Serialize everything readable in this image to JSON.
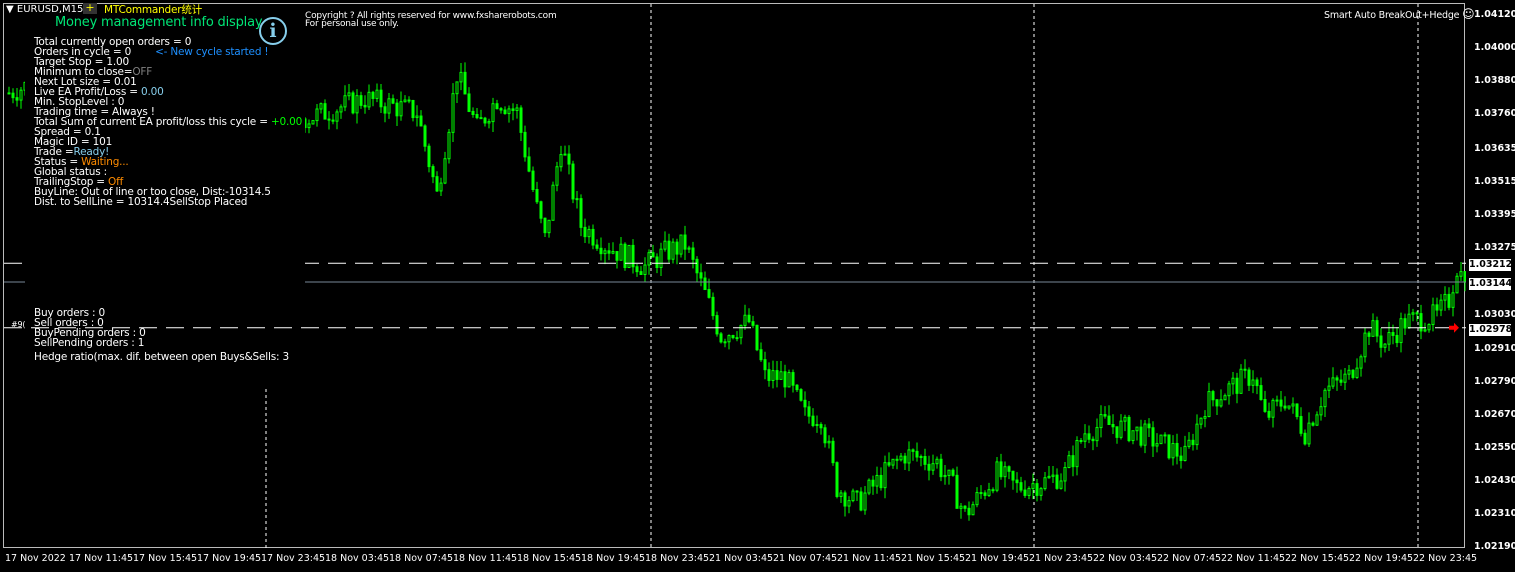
{
  "header": {
    "symbol": "EURUSD,M15",
    "plus_label": "+",
    "indicator_name": "MTCommander统计",
    "copyright_line1": "Copyright ? All rights reserved for www.fxsharerobots.com",
    "copyright_line2": "For personal use only.",
    "ea_name": "Smart Auto BreakOut+Hedge",
    "smiley": "☺"
  },
  "info": {
    "title": "Money management info display",
    "icon": "i",
    "lines": [
      {
        "label": "Total currently open orders = 0",
        "value": ""
      },
      {
        "label": "Orders in cycle = 0",
        "value": "<- New cycle started !"
      },
      {
        "label": "Target Stop = 1.00",
        "value": ""
      },
      {
        "label": "Minimum to close=",
        "value": "OFF"
      },
      {
        "label": "Next Lot size = 0.01",
        "value": ""
      },
      {
        "label": "Live EA Profit/Loss = ",
        "value": "0.00"
      },
      {
        "label": "Min. StopLevel : 0",
        "value": ""
      },
      {
        "label": "Trading time = Always !",
        "value": ""
      },
      {
        "label": "Total Sum of current EA profit/loss this cycle = ",
        "value": "+0.00"
      },
      {
        "label": "Spread = 0.1",
        "value": ""
      },
      {
        "label": "Magic ID = 101",
        "value": ""
      },
      {
        "label": "Trade =",
        "value": "Ready!"
      },
      {
        "label": "Status = ",
        "value": "Waiting..."
      },
      {
        "label": "Global status :",
        "value": ""
      },
      {
        "label": "TrailingStop = ",
        "value": "Off"
      },
      {
        "label": "BuyLine: Out of line or too close, Dist:-10314.5",
        "value": ""
      },
      {
        "label": "Dist. to SellLine = 10314.4SellStop Placed",
        "value": ""
      }
    ],
    "value_colors": [
      "",
      "#1e90ff",
      "",
      "#808080",
      "",
      "#87ceeb",
      "",
      "",
      "#00ff00",
      "",
      "",
      "#87ceeb",
      "#ff8c00",
      "",
      "#ff8c00",
      "",
      ""
    ],
    "orders": [
      "Buy orders : 0",
      "Sell orders : 0",
      "BuyPending orders : 0",
      "SellPending orders : 1"
    ],
    "hedge_ratio": "Hedge ratio(max. dif. between open Buys&Sells: 3",
    "order_tag": "#9("
  },
  "price_axis": [
    "1.04120",
    "1.04000",
    "1.03880",
    "1.03760",
    "1.03635",
    "1.03515",
    "1.03395",
    "1.03275",
    "1.03030",
    "1.02910",
    "1.02790",
    "1.02670",
    "1.02550",
    "1.02430",
    "1.02310",
    "1.02190"
  ],
  "price_range": [
    1.0219,
    1.0412
  ],
  "levels": {
    "sell_line": "1.03212",
    "bid": "1.03144",
    "sell_stop": "1.02978"
  },
  "time_axis": [
    "17 Nov 2022",
    "17 Nov 11:45",
    "17 Nov 15:45",
    "17 Nov 19:45",
    "17 Nov 23:45",
    "18 Nov 03:45",
    "18 Nov 07:45",
    "18 Nov 11:45",
    "18 Nov 15:45",
    "18 Nov 19:45",
    "18 Nov 23:45",
    "21 Nov 03:45",
    "21 Nov 07:45",
    "21 Nov 11:45",
    "21 Nov 15:45",
    "21 Nov 19:45",
    "21 Nov 23:45",
    "22 Nov 03:45",
    "22 Nov 07:45",
    "22 Nov 11:45",
    "22 Nov 15:45",
    "22 Nov 19:45",
    "22 Nov 23:45"
  ],
  "colors": {
    "bull": "#00ff00",
    "bear": "#00ff00",
    "info_title": "#00e676",
    "indicator": "#ffff00"
  },
  "price_anchors": [
    [
      0,
      1.0383
    ],
    [
      5,
      1.0386
    ],
    [
      75,
      1.0374
    ],
    [
      89,
      1.0381
    ],
    [
      102,
      1.0376
    ],
    [
      107,
      1.0346
    ],
    [
      112,
      1.039
    ],
    [
      117,
      1.037
    ],
    [
      122,
      1.0381
    ],
    [
      127,
      1.0376
    ],
    [
      132,
      1.0341
    ],
    [
      134,
      1.033
    ],
    [
      138,
      1.0365
    ],
    [
      143,
      1.0335
    ],
    [
      149,
      1.0328
    ],
    [
      159,
      1.032
    ],
    [
      164,
      1.0325
    ],
    [
      169,
      1.0328
    ],
    [
      174,
      1.031
    ],
    [
      178,
      1.0295
    ],
    [
      185,
      1.03
    ],
    [
      189,
      1.028
    ],
    [
      194,
      1.028
    ],
    [
      199,
      1.0266
    ],
    [
      203,
      1.0266
    ],
    [
      207,
      1.024
    ],
    [
      212,
      1.0234
    ],
    [
      219,
      1.0245
    ],
    [
      224,
      1.0252
    ],
    [
      232,
      1.0249
    ],
    [
      236,
      1.024
    ],
    [
      239,
      1.023
    ],
    [
      247,
      1.0245
    ],
    [
      252,
      1.024
    ],
    [
      259,
      1.0242
    ],
    [
      264,
      1.0245
    ],
    [
      269,
      1.026
    ],
    [
      274,
      1.0263
    ],
    [
      282,
      1.026
    ],
    [
      289,
      1.0255
    ],
    [
      294,
      1.0251
    ],
    [
      299,
      1.027
    ],
    [
      304,
      1.0275
    ],
    [
      311,
      1.0281
    ],
    [
      314,
      1.0265
    ],
    [
      319,
      1.0272
    ],
    [
      324,
      1.026
    ],
    [
      329,
      1.0275
    ],
    [
      335,
      1.028
    ],
    [
      340,
      1.0298
    ],
    [
      344,
      1.0292
    ],
    [
      349,
      1.03
    ],
    [
      357,
      1.0302
    ],
    [
      360,
      1.0308
    ],
    [
      362,
      1.032
    ],
    [
      364,
      1.03144
    ]
  ]
}
